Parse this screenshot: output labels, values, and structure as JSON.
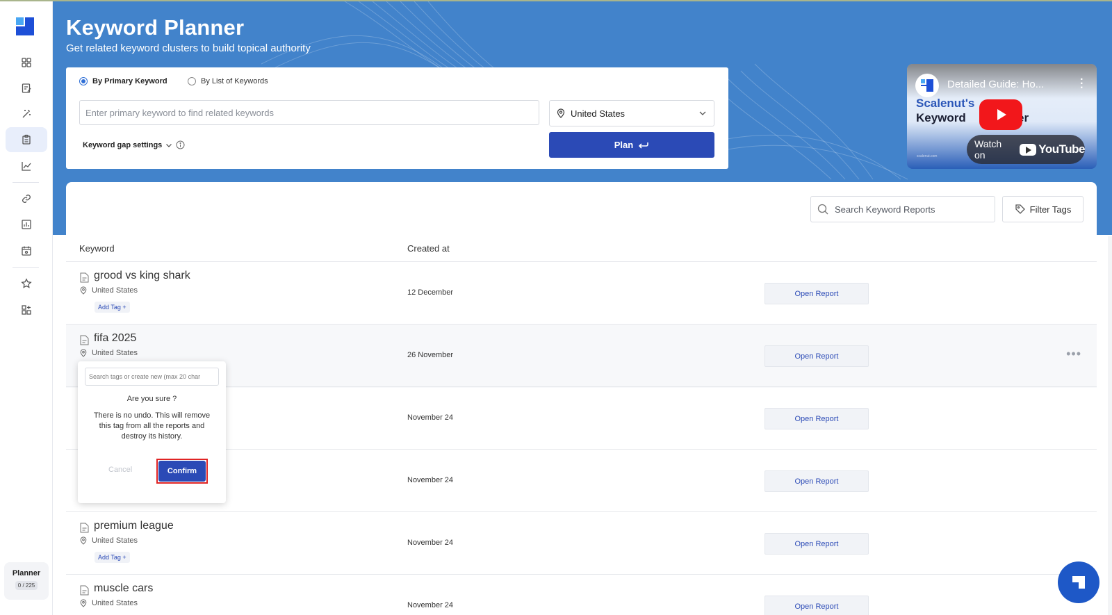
{
  "header": {
    "title": "Keyword Planner",
    "subtitle": "Get related keyword clusters to build topical authority"
  },
  "planner_form": {
    "mode_primary": "By Primary Keyword",
    "mode_list": "By List of Keywords",
    "selected_mode": "By Primary Keyword",
    "keyword_placeholder": "Enter primary keyword to find related keywords",
    "keyword_value": "",
    "country": "United States",
    "gap_settings_label": "Keyword gap settings",
    "plan_label": "Plan"
  },
  "video": {
    "title": "Detailed Guide: Ho...",
    "brand_line1": "Scalenut's",
    "brand_line2": "Keyword",
    "brand_line2b": "er",
    "watch_on": "Watch on",
    "youtube": "YouTube",
    "small_text": "scalenut.com"
  },
  "reports": {
    "search_placeholder": "Search Keyword Reports",
    "filter_label": "Filter Tags",
    "columns": {
      "keyword": "Keyword",
      "created": "Created at"
    },
    "open_label": "Open Report",
    "add_tag_label": "Add Tag +",
    "rows": [
      {
        "name": "grood vs king shark",
        "location": "United States",
        "date": "12 December"
      },
      {
        "name": "fifa 2025",
        "location": "United States",
        "date": "26 November"
      },
      {
        "name": "",
        "location": "",
        "date": "November 24"
      },
      {
        "name": "",
        "location": "",
        "date": "November 24"
      },
      {
        "name": "premium league",
        "location": "United States",
        "date": "November 24"
      },
      {
        "name": "muscle cars",
        "location": "United States",
        "date": "November 24"
      }
    ]
  },
  "confirm_dialog": {
    "search_placeholder": "Search tags or create new (max 20 char",
    "question": "Are you sure ?",
    "message": "There is no undo. This will remove this tag from all the reports and destroy its history.",
    "cancel": "Cancel",
    "confirm": "Confirm"
  },
  "sidebar": {
    "plan_name": "Planner",
    "plan_usage": "0 / 225"
  },
  "colors": {
    "hero": "#4283cb",
    "primary_button": "#2b4ab6",
    "highlight_outline": "#e02424"
  }
}
